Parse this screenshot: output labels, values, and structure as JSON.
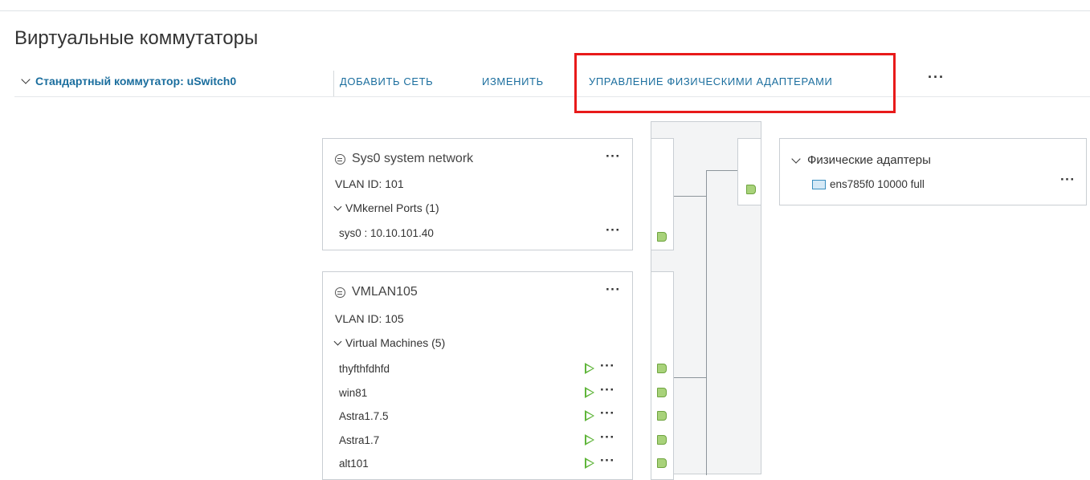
{
  "page": {
    "title": "Виртуальные коммутаторы"
  },
  "toolbar": {
    "switch_label": "Стандартный коммутатор: uSwitch0",
    "add_network": "ДОБАВИТЬ СЕТЬ",
    "edit": "ИЗМЕНИТЬ",
    "manage_adapters": "УПРАВЛЕНИЕ ФИЗИЧЕСКИМИ АДАПТЕРАМИ",
    "more": "···"
  },
  "networks": [
    {
      "title": "Sys0 system network",
      "vlan": "VLAN ID: 101",
      "group": "VMkernel Ports (1)",
      "items": [
        {
          "label": "sys0 : 10.10.101.40"
        }
      ]
    },
    {
      "title": "VMLAN105",
      "vlan": "VLAN ID: 105",
      "group": "Virtual Machines (5)",
      "items": [
        {
          "label": "thyfthfdhfd"
        },
        {
          "label": "win81"
        },
        {
          "label": "Astra1.7.5"
        },
        {
          "label": "Astra1.7"
        },
        {
          "label": "alt101"
        }
      ]
    }
  ],
  "physical": {
    "title": "Физические адаптеры",
    "adapter": "ens785f0 10000 full"
  },
  "icons": {
    "network": "network-icon",
    "vm_power": "power-on-icon",
    "port": "port-icon",
    "nic": "nic-icon",
    "expand": "chevron-down-icon",
    "more": "more-icon"
  },
  "colors": {
    "link": "#1b6e9e",
    "highlight": "#e81a1a",
    "port": "#a8d27a",
    "power": "#5fb53a"
  }
}
